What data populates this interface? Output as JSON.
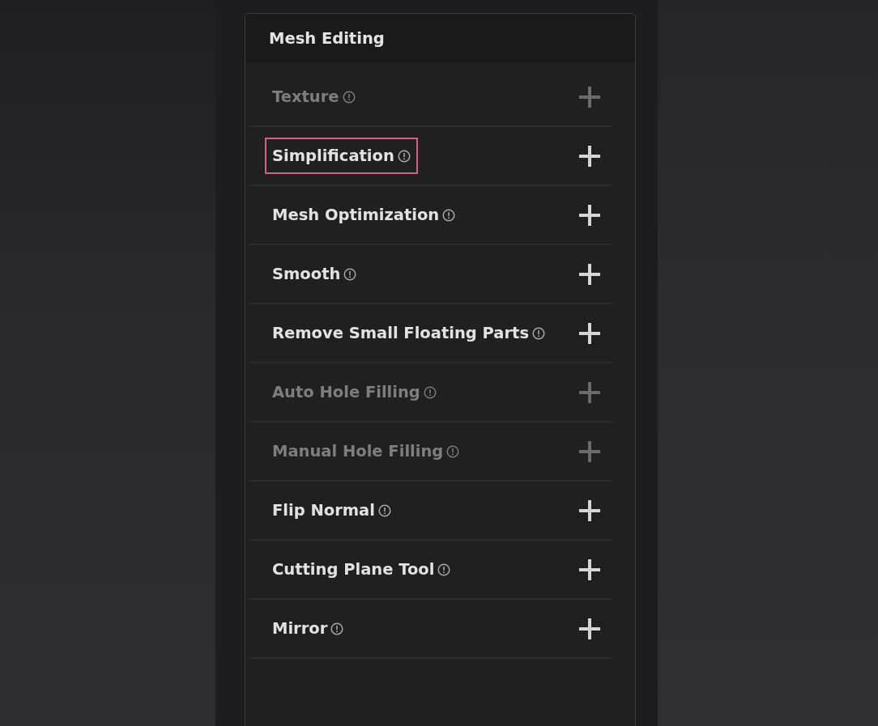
{
  "panel": {
    "title": "Mesh Editing"
  },
  "sections": [
    {
      "label": "Texture",
      "disabled": true,
      "highlighted": false
    },
    {
      "label": "Simplification",
      "disabled": false,
      "highlighted": true
    },
    {
      "label": "Mesh Optimization",
      "disabled": false,
      "highlighted": false
    },
    {
      "label": "Smooth",
      "disabled": false,
      "highlighted": false
    },
    {
      "label": "Remove Small Floating Parts",
      "disabled": false,
      "highlighted": false
    },
    {
      "label": "Auto Hole Filling",
      "disabled": true,
      "highlighted": false
    },
    {
      "label": "Manual Hole Filling",
      "disabled": true,
      "highlighted": false
    },
    {
      "label": "Flip Normal",
      "disabled": false,
      "highlighted": false
    },
    {
      "label": "Cutting Plane Tool",
      "disabled": false,
      "highlighted": false
    },
    {
      "label": "Mirror",
      "disabled": false,
      "highlighted": false
    }
  ]
}
